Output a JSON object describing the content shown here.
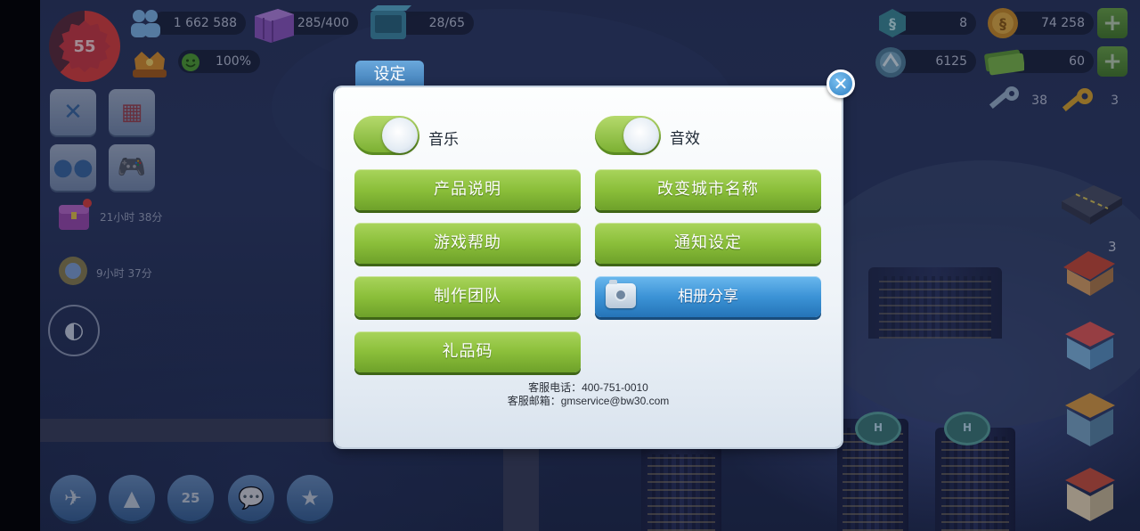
{
  "hud": {
    "level": "55",
    "population": "1 662 588",
    "storage": "285/400",
    "workers": "28/65",
    "happiness": "100%",
    "simcash": "8",
    "simoleons": "74 258",
    "neosimoleons": "6125",
    "golden_keys_cash": "60",
    "platinum_keys": "38",
    "golden_keys": "3",
    "side_count": "3",
    "timer1": "21小时 38分",
    "timer2": "9小时 37分",
    "round_badge": "25"
  },
  "icons": {
    "population": "people-icon",
    "storage": "storage-icon",
    "workers": "factory-icon",
    "happiness": "smiley-icon",
    "simcash": "simcash-icon",
    "simoleons": "simoleon-coin-icon",
    "neosim": "neosim-icon",
    "cash_bills": "cash-icon",
    "key_platinum": "platinum-key-icon",
    "key_golden": "golden-key-icon"
  },
  "colors": {
    "green_button": "#8bbf3a",
    "blue_button": "#3c93d6",
    "tab_blue": "#4f8fc8",
    "level_red": "#c93a46"
  },
  "dialog": {
    "tab_title": "设定",
    "music_label": "音乐",
    "music_on": true,
    "sfx_label": "音效",
    "sfx_on": true,
    "buttons": {
      "product_info": "产品说明",
      "rename_city": "改变城市名称",
      "game_help": "游戏帮助",
      "notification_settings": "通知设定",
      "credits": "制作团队",
      "album_share": "相册分享",
      "gift_code": "礼品码"
    },
    "service_phone": "客服电话：400-751-0010",
    "service_email": "客服邮箱：gmservice@bw30.com"
  }
}
